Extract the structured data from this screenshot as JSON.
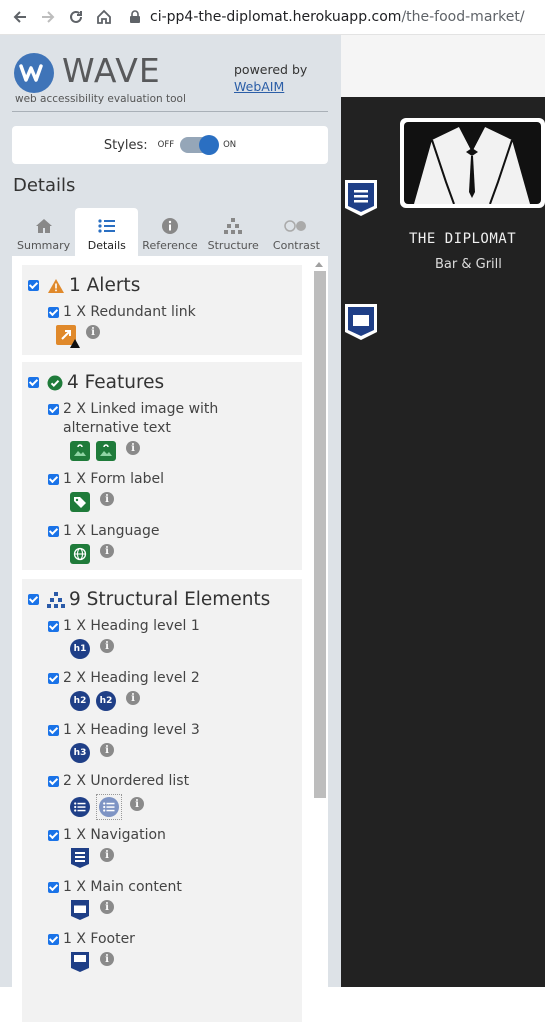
{
  "browser": {
    "url_host": "ci-pp4-the-diplomat.herokuapp.com",
    "url_path": "/the-food-market/"
  },
  "wave": {
    "title": "WAVE",
    "subtitle": "web accessibility evaluation tool",
    "powered_by": "powered by",
    "webaim_link": "WebAIM",
    "styles_label": "Styles:",
    "toggle_off": "OFF",
    "toggle_on": "ON",
    "details_heading": "Details",
    "tabs": [
      {
        "label": "Summary",
        "icon": "home-icon",
        "active": false
      },
      {
        "label": "Details",
        "icon": "list-icon",
        "active": true
      },
      {
        "label": "Reference",
        "icon": "info-icon",
        "active": false
      },
      {
        "label": "Structure",
        "icon": "structure-icon",
        "active": false
      },
      {
        "label": "Contrast",
        "icon": "contrast-icon",
        "active": false
      }
    ],
    "sections": {
      "alerts": {
        "title": "1 Alerts",
        "items": [
          {
            "label": "1 X Redundant link"
          }
        ]
      },
      "features": {
        "title": "4 Features",
        "items": [
          {
            "label": "2 X Linked image with alternative text"
          },
          {
            "label": "1 X Form label"
          },
          {
            "label": "1 X Language"
          }
        ]
      },
      "structure": {
        "title": "9 Structural Elements",
        "items": [
          {
            "label": "1 X Heading level 1",
            "badge": "h1"
          },
          {
            "label": "2 X Heading level 2",
            "badge": "h2"
          },
          {
            "label": "1 X Heading level 3",
            "badge": "h3"
          },
          {
            "label": "2 X Unordered list"
          },
          {
            "label": "1 X Navigation"
          },
          {
            "label": "1 X Main content"
          },
          {
            "label": "1 X Footer"
          }
        ]
      }
    },
    "info_glyph": "i"
  },
  "preview": {
    "brand_name": "THE DIPLOMAT",
    "brand_sub": "Bar & Grill"
  },
  "colors": {
    "wave_bg": "#dde2e7",
    "accent_blue": "#2a6fc2",
    "feature_green": "#1f7b3a",
    "structure_navy": "#1f3f87",
    "alert_orange": "#e0892b",
    "preview_bg": "#222222"
  }
}
